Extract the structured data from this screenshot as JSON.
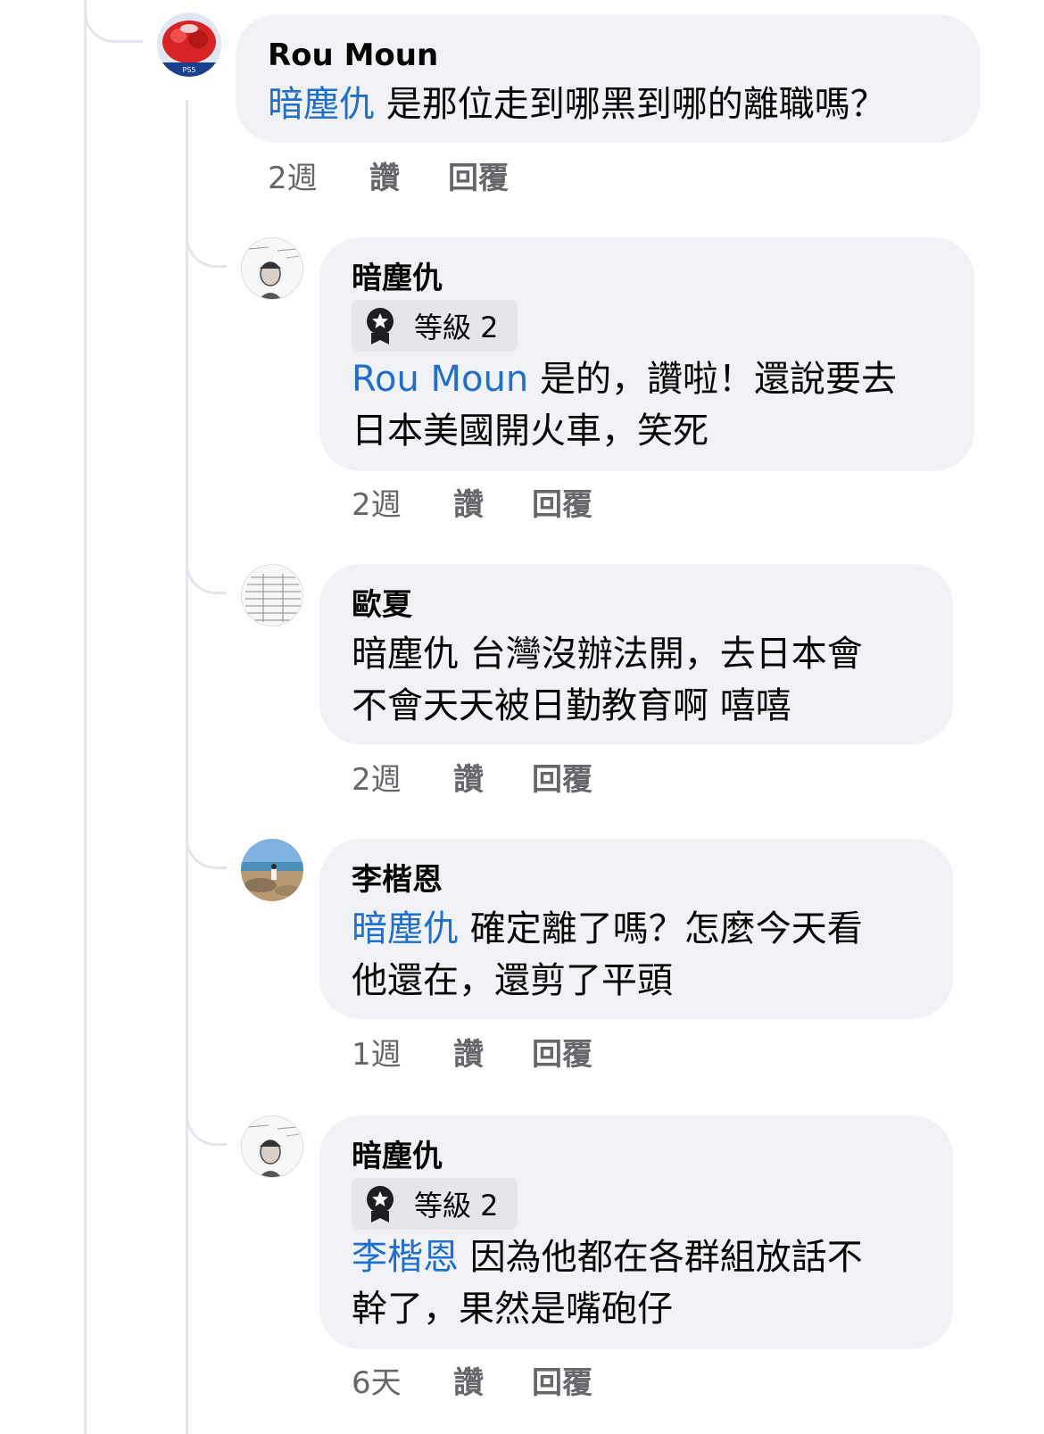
{
  "comments": [
    {
      "author": "Rou Moun",
      "mention": "暗塵仇",
      "lines": [
        " 是那位走到哪黑到哪的離職嗎？"
      ],
      "time": "2週",
      "like": "讚",
      "reply": "回覆"
    },
    {
      "author": "暗塵仇",
      "badge": "等級 2",
      "mention": "Rou Moun",
      "lines": [
        " 是的，讚啦！還說要去",
        "日本美國開火車，笑死"
      ],
      "time": "2週",
      "like": "讚",
      "reply": "回覆"
    },
    {
      "author": "歐夏",
      "lines": [
        "暗塵仇 台灣沒辦法開，去日本會",
        "不會天天被日勤教育啊 嘻嘻"
      ],
      "time": "2週",
      "like": "讚",
      "reply": "回覆"
    },
    {
      "author": "李楷恩",
      "mention": "暗塵仇",
      "lines": [
        " 確定離了嗎？怎麼今天看",
        "他還在，還剪了平頭"
      ],
      "time": "1週",
      "like": "讚",
      "reply": "回覆"
    },
    {
      "author": "暗塵仇",
      "badge": "等級 2",
      "mention": "李楷恩",
      "lines": [
        " 因為他都在各群組放話不",
        "幹了，果然是嘴砲仔"
      ],
      "time": "6天",
      "like": "讚",
      "reply": "回覆"
    }
  ],
  "colors": {
    "bubble": "#f0f2f5",
    "mention": "#1f6fd1",
    "meta": "#65676b",
    "thread_line": "#e4e6eb",
    "badge_bg": "#e4e6eb"
  },
  "icons": {
    "badge": "star-medal-icon"
  }
}
